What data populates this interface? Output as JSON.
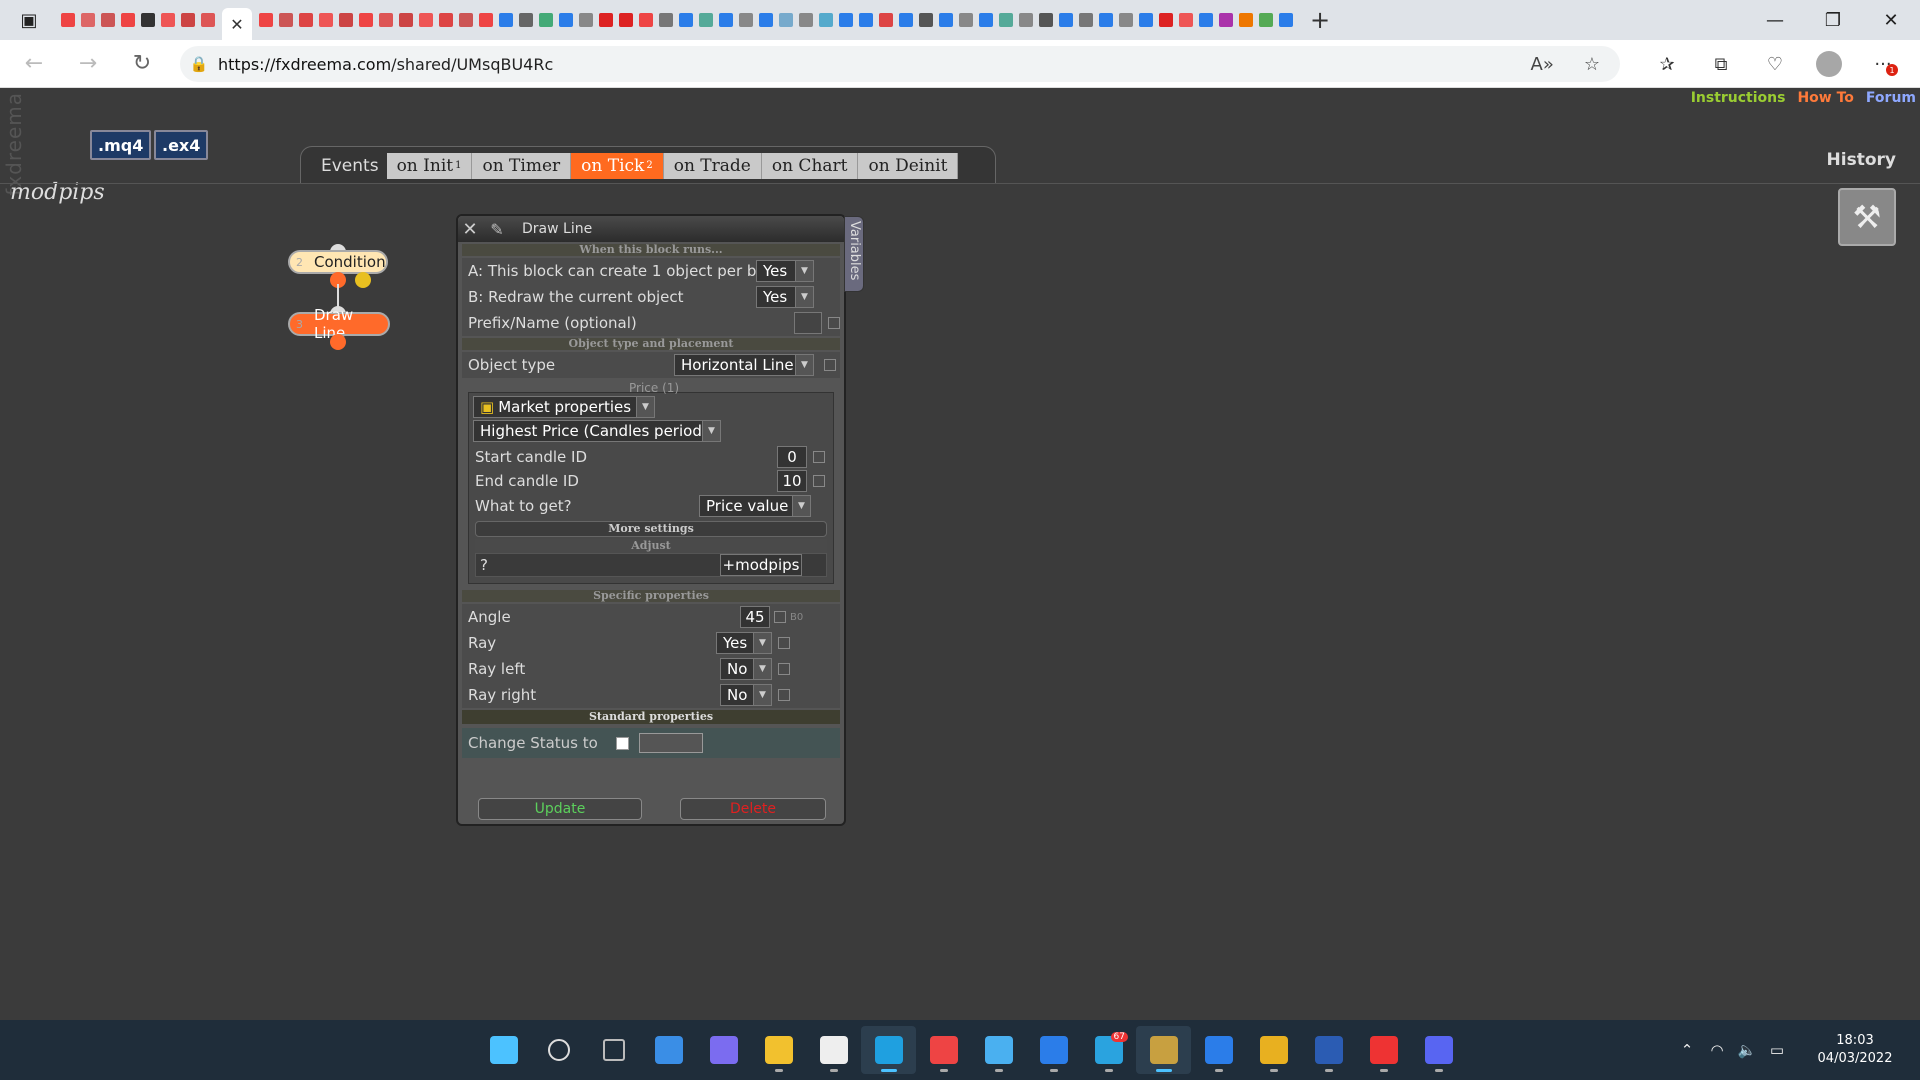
{
  "browser": {
    "url_host": "https://fxdreema.com",
    "url_path": "/shared/UMsqBU4Rc",
    "tab_close": "✕",
    "new_tab": "+"
  },
  "app": {
    "brand_vertical": "fxdreema",
    "project_name": "modpips",
    "toplinks": {
      "instructions": "Instructions",
      "howto": "How To",
      "forum": "Forum"
    },
    "file_buttons": {
      "mq4": ".mq4",
      "ex4": ".ex4"
    },
    "history_label": "History",
    "events_label": "Events",
    "event_tabs": [
      {
        "label": "on Init",
        "badge": "1"
      },
      {
        "label": "on Timer",
        "badge": ""
      },
      {
        "label": "on Tick",
        "badge": "2"
      },
      {
        "label": "on Trade",
        "badge": ""
      },
      {
        "label": "on Chart",
        "badge": ""
      },
      {
        "label": "on Deinit",
        "badge": ""
      }
    ],
    "active_event": "on Tick",
    "blocks": [
      {
        "num": "2",
        "label": "Condition"
      },
      {
        "num": "3",
        "label": "Draw Line"
      }
    ]
  },
  "dialog": {
    "title": "Draw Line",
    "variables_tab": "Variables",
    "sections": {
      "when_runs": "When this block runs...",
      "object_type_placement": "Object type and placement",
      "specific": "Specific properties",
      "standard": "Standard properties"
    },
    "rows": {
      "a_label": "A: This block can create 1 object per bar",
      "a_value": "Yes",
      "b_label": "B: Redraw the current object",
      "b_value": "Yes",
      "prefix_label": "Prefix/Name (optional)",
      "object_type_label": "Object type",
      "object_type_value": "Horizontal Line"
    },
    "price": {
      "label": "Price (1)",
      "source": "Market properties",
      "function": "Highest Price (Candles period)",
      "start_label": "Start candle ID",
      "start_value": "0",
      "end_label": "End candle ID",
      "end_value": "10",
      "what_label": "What to get?",
      "what_value": "Price value",
      "more_settings": "More settings",
      "adjust": "Adjust",
      "adjust_q": "?",
      "adjust_value": "+modpips"
    },
    "specific": {
      "angle_label": "Angle",
      "angle_value": "45",
      "angle_hint": "B0",
      "ray_label": "Ray",
      "ray_value": "Yes",
      "ray_left_label": "Ray left",
      "ray_left_value": "No",
      "ray_right_label": "Ray right",
      "ray_right_value": "No"
    },
    "change_status_label": "Change Status to",
    "update_label": "Update",
    "delete_label": "Delete"
  },
  "taskbar": {
    "telegram_badge": "67",
    "time": "18:03",
    "date": "04/03/2022"
  },
  "colors": {
    "accent_orange": "#ff6a1f",
    "condition_block": "#ffe6b3",
    "update_green": "#5cd05c",
    "delete_red": "#e02020"
  }
}
